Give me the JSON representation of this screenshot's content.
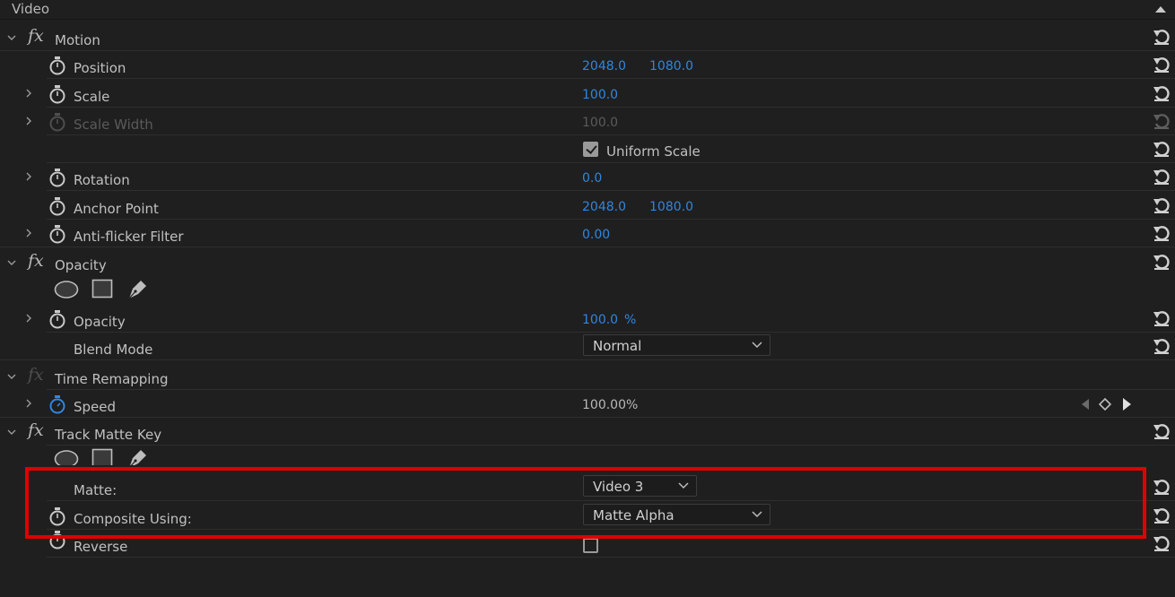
{
  "section_title": "Video",
  "motion": {
    "title": "Motion",
    "position": {
      "label": "Position",
      "x": "2048.0",
      "y": "1080.0"
    },
    "scale": {
      "label": "Scale",
      "value": "100.0"
    },
    "scale_width": {
      "label": "Scale Width",
      "value": "100.0"
    },
    "uniform_scale": {
      "label": "Uniform Scale",
      "checked": true
    },
    "rotation": {
      "label": "Rotation",
      "value": "0.0"
    },
    "anchor_point": {
      "label": "Anchor Point",
      "x": "2048.0",
      "y": "1080.0"
    },
    "anti_flicker": {
      "label": "Anti-flicker Filter",
      "value": "0.00"
    }
  },
  "opacity": {
    "title": "Opacity",
    "opacity": {
      "label": "Opacity",
      "value": "100.0",
      "unit": "%"
    },
    "blend_mode": {
      "label": "Blend Mode",
      "value": "Normal"
    }
  },
  "time_remapping": {
    "title": "Time Remapping",
    "speed": {
      "label": "Speed",
      "value": "100.00%"
    }
  },
  "track_matte_key": {
    "title": "Track Matte Key",
    "matte": {
      "label": "Matte:",
      "value": "Video 3"
    },
    "composite_using": {
      "label": "Composite Using:",
      "value": "Matte Alpha"
    },
    "reverse": {
      "label": "Reverse",
      "checked": false
    }
  },
  "colors": {
    "accent": "#2f86e0",
    "highlight": "#e00000",
    "background": "#1f1f1f"
  },
  "icons": [
    "chevron-down-icon",
    "chevron-right-icon",
    "fx-icon",
    "stopwatch-icon",
    "reset-icon",
    "ellipse-mask-icon",
    "rectangle-mask-icon",
    "pen-mask-icon",
    "keyframe-prev-icon",
    "keyframe-add-icon",
    "keyframe-next-icon"
  ]
}
